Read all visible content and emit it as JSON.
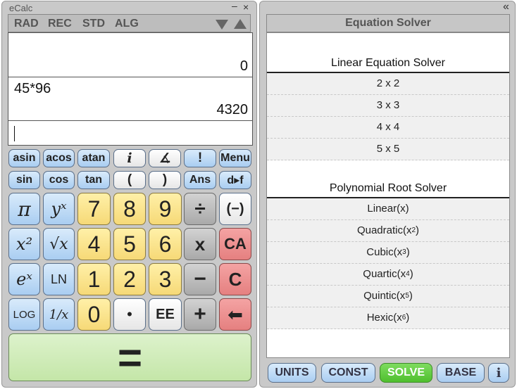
{
  "app": {
    "title": "eCalc"
  },
  "window": {
    "minimize": "–",
    "close": "×",
    "collapse": "«"
  },
  "modebar": {
    "items": [
      "RAD",
      "REC",
      "STD",
      "ALG"
    ]
  },
  "display": {
    "result_top": "0",
    "expression": "45*96",
    "result": "4320",
    "input": ""
  },
  "keys": {
    "row1": [
      "asin",
      "acos",
      "atan",
      "i",
      "∡",
      "!",
      "Menu"
    ],
    "row2": [
      "sin",
      "cos",
      "tan",
      "(",
      ")",
      "Ans",
      "d▸f"
    ],
    "row3": [
      "π",
      "yˣ",
      "7",
      "8",
      "9",
      "÷",
      "(−)"
    ],
    "row4": [
      "x²",
      "√x",
      "4",
      "5",
      "6",
      "x",
      "CA"
    ],
    "row5": [
      "eˣ",
      "LN",
      "1",
      "2",
      "3",
      "−",
      "C"
    ],
    "row6": [
      "LOG",
      "1/x",
      "0",
      "•",
      "EE",
      "+",
      "⬅"
    ],
    "equals": "="
  },
  "solver": {
    "header": "Equation Solver",
    "linear_title": "Linear Equation Solver",
    "linear_items": [
      "2 x 2",
      "3 x 3",
      "4 x 4",
      "5 x 5"
    ],
    "poly_title": "Polynomial Root Solver",
    "poly_items": [
      {
        "name": "Linear(x)",
        "base": "Linear(x",
        "exp": "",
        "close": ")"
      },
      {
        "name": "Quadratic",
        "base": "Quadratic(x",
        "exp": "2",
        "close": ")"
      },
      {
        "name": "Cubic",
        "base": "Cubic(x",
        "exp": "3",
        "close": ")"
      },
      {
        "name": "Quartic",
        "base": "Quartic(x",
        "exp": "4",
        "close": ")"
      },
      {
        "name": "Quintic",
        "base": "Quintic(x",
        "exp": "5",
        "close": ")"
      },
      {
        "name": "Hexic",
        "base": "Hexic(x",
        "exp": "6",
        "close": ")"
      }
    ]
  },
  "tabs": [
    "UNITS",
    "CONST",
    "SOLVE",
    "BASE",
    "i"
  ],
  "colors": {
    "solve_active": "#4fbf2e",
    "equals_key": "#c4e6a8",
    "clear_key": "#e58080",
    "digit_key": "#f6d977"
  }
}
